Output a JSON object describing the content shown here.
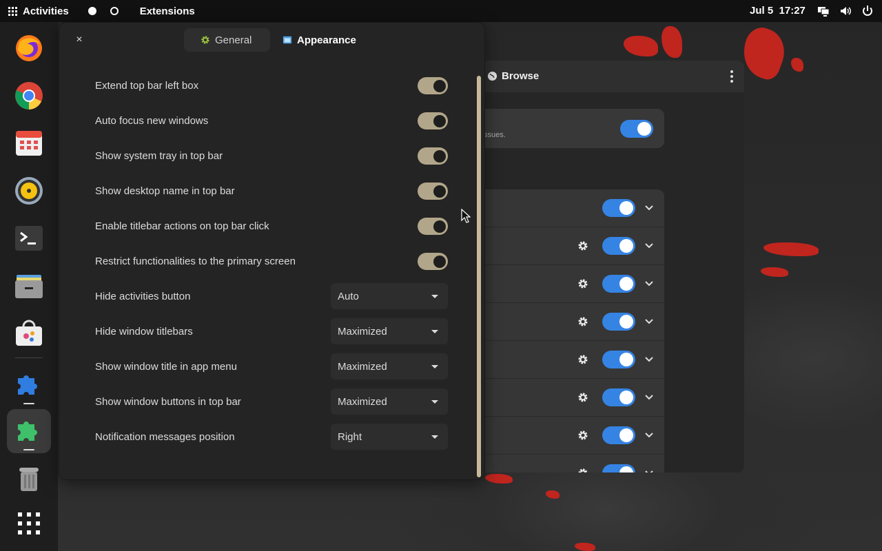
{
  "topbar": {
    "activities_label": "Activities",
    "app_name": "Extensions",
    "date": "Jul 5",
    "time": "17:27",
    "tray_icons": [
      "display-icon",
      "volume-icon",
      "power-icon"
    ]
  },
  "dock": {
    "apps": [
      {
        "name": "firefox-icon"
      },
      {
        "name": "chrome-icon"
      },
      {
        "name": "calendar-icon"
      },
      {
        "name": "rhythmbox-icon"
      },
      {
        "name": "terminal-icon"
      },
      {
        "name": "files-icon"
      },
      {
        "name": "software-icon"
      },
      {
        "name": "extension-manager-icon"
      },
      {
        "name": "extensions-icon"
      },
      {
        "name": "trash-icon"
      },
      {
        "name": "app-grid-icon"
      }
    ]
  },
  "background_window": {
    "header_title": "Browse",
    "card_text": "ssues."
  },
  "dialog": {
    "close_glyph": "×",
    "tabs": [
      {
        "label": "General",
        "icon": "gear-icon",
        "selected": false
      },
      {
        "label": "Appearance",
        "icon": "window-icon",
        "selected": true
      }
    ],
    "toggles": [
      {
        "label": "Extend top bar left box",
        "on": true
      },
      {
        "label": "Auto focus new windows",
        "on": true
      },
      {
        "label": "Show system tray in top bar",
        "on": true
      },
      {
        "label": "Show desktop name in top bar",
        "on": true
      },
      {
        "label": "Enable titlebar actions on top bar click",
        "on": true
      },
      {
        "label": "Restrict functionalities to the primary screen",
        "on": true
      }
    ],
    "dropdowns": [
      {
        "label": "Hide activities button",
        "value": "Auto"
      },
      {
        "label": "Hide window titlebars",
        "value": "Maximized"
      },
      {
        "label": "Show window title in app menu",
        "value": "Maximized"
      },
      {
        "label": "Show window buttons in top bar",
        "value": "Maximized"
      },
      {
        "label": "Notification messages position",
        "value": "Right"
      }
    ]
  },
  "colors": {
    "switch_on": "#b2a68a",
    "accent_blue": "#3584e4",
    "wallpaper_splat": "#c8251d"
  }
}
